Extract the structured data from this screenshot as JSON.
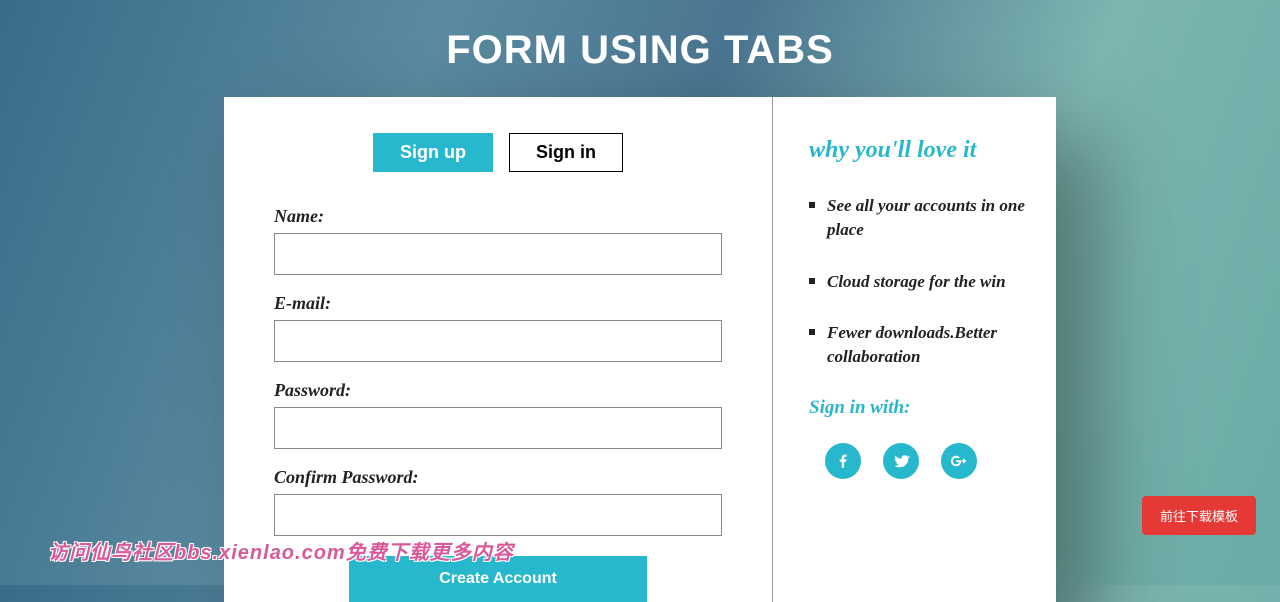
{
  "title": "FORM USING TABS",
  "tabs": {
    "signup": "Sign up",
    "signin": "Sign in"
  },
  "form": {
    "name_label": "Name:",
    "email_label": "E-mail:",
    "password_label": "Password:",
    "confirm_label": "Confirm Password:",
    "submit": "Create Account"
  },
  "sidebar": {
    "love_title": "why you'll love it",
    "benefits": [
      "See all your accounts in one place",
      "Cloud storage for the win",
      "Fewer downloads.Better collaboration"
    ],
    "signin_with": "Sign in with:"
  },
  "bottom_button": "前往下载模板",
  "watermark": "访问仙鸟社区bbs.xienlao.com免费下载更多内容"
}
